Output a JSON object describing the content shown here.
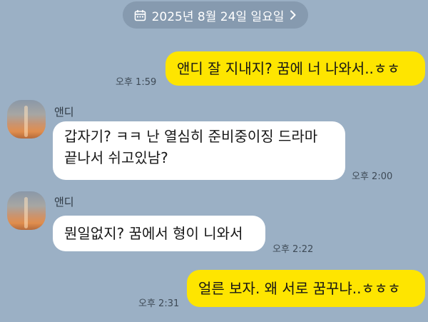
{
  "date_divider": {
    "label": "2025년 8월 24일 일요일"
  },
  "icons": {
    "calendar": "calendar-icon",
    "chevron": "chevron-right-icon",
    "avatar": "profile-sunset-photo"
  },
  "colors": {
    "background": "#9bb0c5",
    "my_bubble": "#fee500",
    "their_bubble": "#ffffff"
  },
  "messages": [
    {
      "side": "me",
      "text": "앤디 잘 지내지? 꿈에 너 나와서..ㅎㅎ",
      "time": "오후 1:59"
    },
    {
      "side": "other",
      "sender": "앤디",
      "text": "갑자기? ㅋㅋ 난 열심히 준비중이징 드라마 끝나서 쉬고있남?",
      "time": "오후 2:00"
    },
    {
      "side": "other",
      "sender": "앤디",
      "text": "뭔일없지? 꿈에서 형이 니와서",
      "time": "오후 2:22"
    },
    {
      "side": "me",
      "text": "얼른 보자. 왜 서로 꿈꾸냐..ㅎㅎㅎ",
      "time": "오후 2:31"
    }
  ]
}
